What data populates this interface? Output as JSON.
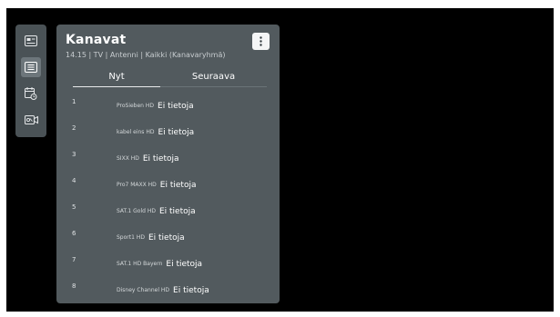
{
  "rail": {
    "items": [
      {
        "icon": "guide-icon",
        "active": false
      },
      {
        "icon": "channel-list-icon",
        "active": true
      },
      {
        "icon": "schedule-icon",
        "active": false
      },
      {
        "icon": "recordings-icon",
        "active": false
      }
    ]
  },
  "panel": {
    "title": "Kanavat",
    "subtitle": "14.15 | TV | Antenni | Kaikki (Kanavaryhmä)",
    "menu_icon": "more-vertical-icon"
  },
  "tabs": [
    {
      "label": "Nyt",
      "selected": true
    },
    {
      "label": "Seuraava",
      "selected": false
    }
  ],
  "channels": [
    {
      "number": "1",
      "name": "ProSieben HD",
      "info": "Ei tietoja"
    },
    {
      "number": "2",
      "name": "kabel eins HD",
      "info": "Ei tietoja"
    },
    {
      "number": "3",
      "name": "SIXX HD",
      "info": "Ei tietoja"
    },
    {
      "number": "4",
      "name": "Pro7 MAXX HD",
      "info": "Ei tietoja"
    },
    {
      "number": "5",
      "name": "SAT.1 Gold HD",
      "info": "Ei tietoja"
    },
    {
      "number": "6",
      "name": "Sport1 HD",
      "info": "Ei tietoja"
    },
    {
      "number": "7",
      "name": "SAT.1 HD Bayern",
      "info": "Ei tietoja"
    },
    {
      "number": "8",
      "name": "Disney Channel HD",
      "info": "Ei tietoja"
    }
  ]
}
